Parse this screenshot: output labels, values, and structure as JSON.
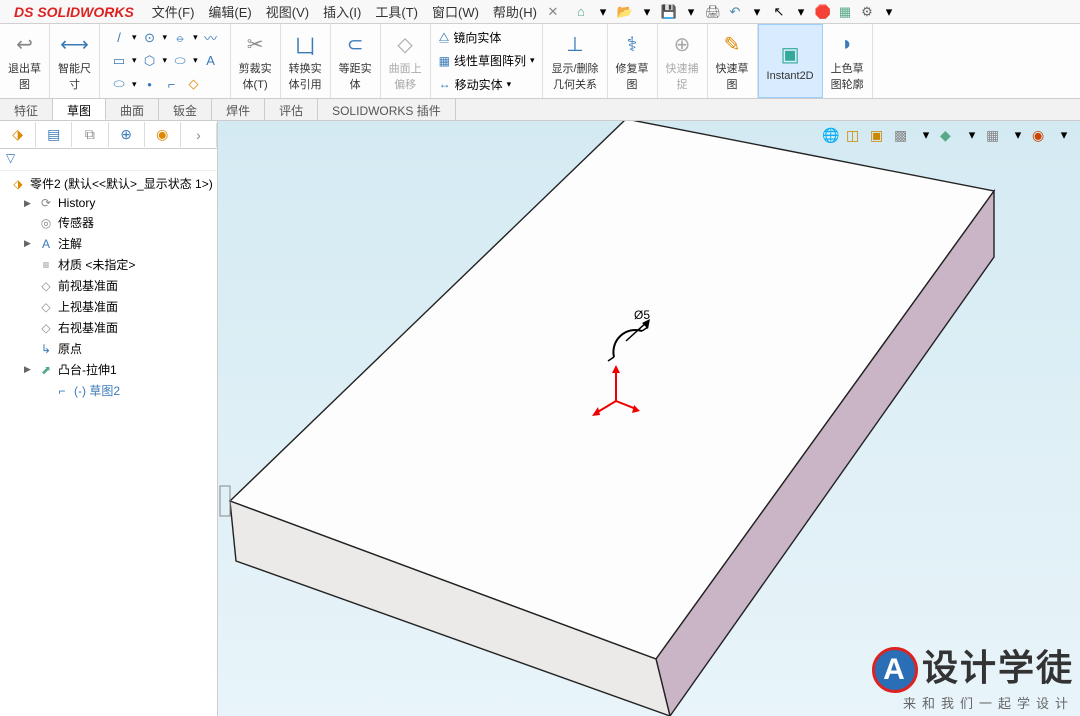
{
  "app": {
    "logo_prefix": "DS",
    "logo_name": "SOLIDWORKS"
  },
  "menu": {
    "file": "文件(F)",
    "edit": "编辑(E)",
    "view": "视图(V)",
    "insert": "插入(I)",
    "tools": "工具(T)",
    "window": "窗口(W)",
    "help": "帮助(H)"
  },
  "toolbar": {
    "exit_sketch": "退出草\n图",
    "smart_dim": "智能尺\n寸",
    "trim": "剪裁实\n体(T)",
    "convert": "转换实\n体引用",
    "offset": "等距实\n体",
    "surface_offset": "曲面上\n偏移",
    "mirror": "镜向实体",
    "linear_pattern": "线性草图阵列",
    "move": "移动实体",
    "display_delete": "显示/删除\n几何关系",
    "repair": "修复草\n图",
    "quick_snap": "快速捕\n捉",
    "quick_sketch": "快速草\n图",
    "instant2d": "Instant2D",
    "contour": "上色草\n图轮廓"
  },
  "tabs": {
    "feature": "特征",
    "sketch": "草图",
    "surface": "曲面",
    "sheet": "钣金",
    "weld": "焊件",
    "eval": "评估",
    "plugin": "SOLIDWORKS 插件"
  },
  "tree": {
    "root": "零件2 (默认<<默认>_显示状态 1>)",
    "history": "History",
    "sensor": "传感器",
    "annotation": "注解",
    "material": "材质 <未指定>",
    "front": "前视基准面",
    "top": "上视基准面",
    "right": "右视基准面",
    "origin": "原点",
    "extrude": "凸台-拉伸1",
    "sketch2": "(-) 草图2"
  },
  "sketch_label": "Ø5",
  "watermark": {
    "brand": "设计学徒",
    "sub": "来和我们一起学设计"
  }
}
